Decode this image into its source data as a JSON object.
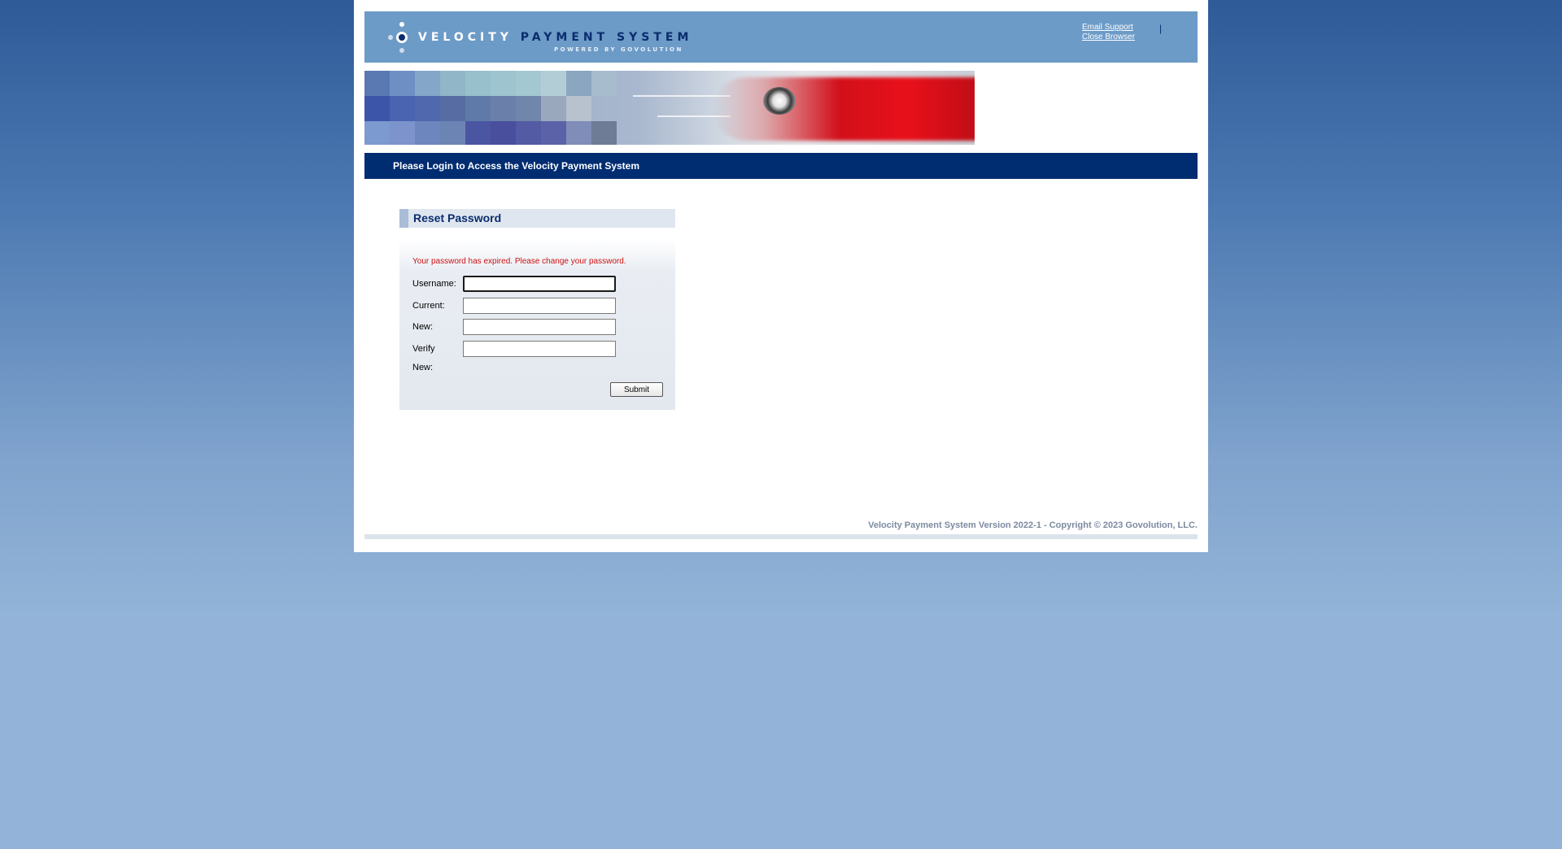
{
  "header": {
    "logo_name_part1": "VELOCITY",
    "logo_name_part2": "PAYMENT SYSTEM",
    "logo_powered": "POWERED BY GOVOLUTION",
    "links": {
      "email_support": "Email Support",
      "close_browser": "Close Browser",
      "separator": "|"
    }
  },
  "navbar": {
    "text": "Please Login to Access the Velocity Payment System"
  },
  "panel": {
    "title": "Reset Password",
    "error_message": "Your password has expired. Please change your password.",
    "fields": [
      {
        "label": "Username:",
        "value": ""
      },
      {
        "label": "Current:",
        "value": ""
      },
      {
        "label": "New:",
        "value": ""
      },
      {
        "label": "Verify New:",
        "value": ""
      }
    ],
    "verify_label_line1": "Verify",
    "verify_label_line2": "New:",
    "submit_label": "Submit"
  },
  "footer": {
    "text": "Velocity Payment System Version 2022-1 - Copyright © 2023 Govolution, LLC."
  },
  "colors": {
    "header_bg": "#6c9bc7",
    "navbar_bg": "#002d72",
    "title_color": "#0b2d6e",
    "error_color": "#cc1111"
  },
  "icons": {
    "logo": "velocity-dots-icon"
  }
}
